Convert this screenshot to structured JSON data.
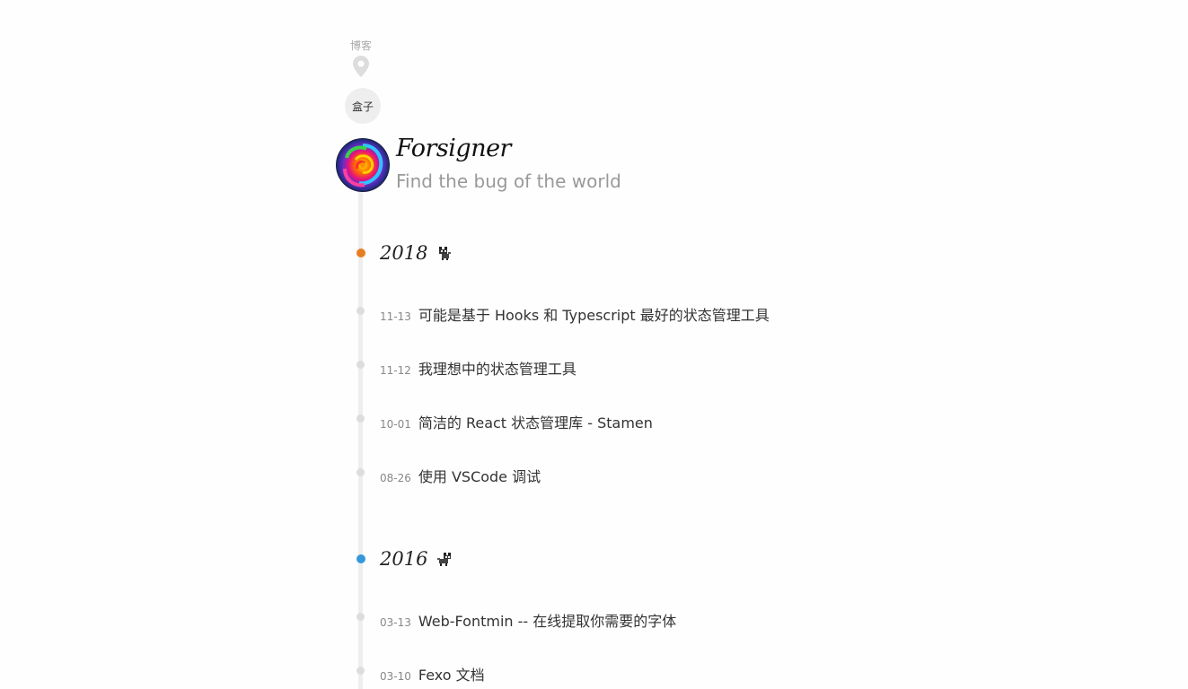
{
  "nav": {
    "blog_label": "博客",
    "box_label": "盒子"
  },
  "site": {
    "title": "Forsigner",
    "subtitle": "Find the bug of the world"
  },
  "years": [
    {
      "year": "2018",
      "dot_color": "#e67e22",
      "icon": "pixel-cat-icon",
      "posts": [
        {
          "date": "11-13",
          "title": "可能是基于 Hooks 和 Typescript 最好的状态管理工具"
        },
        {
          "date": "11-12",
          "title": "我理想中的状态管理工具"
        },
        {
          "date": "10-01",
          "title": "简洁的 React 状态管理库 - Stamen"
        },
        {
          "date": "08-26",
          "title": "使用 VSCode 调试"
        }
      ]
    },
    {
      "year": "2016",
      "dot_color": "#3498db",
      "icon": "pixel-cat-icon",
      "posts": [
        {
          "date": "03-13",
          "title": "Web-Fontmin -- 在线提取你需要的字体"
        },
        {
          "date": "03-10",
          "title": "Fexo 文档"
        }
      ]
    }
  ]
}
